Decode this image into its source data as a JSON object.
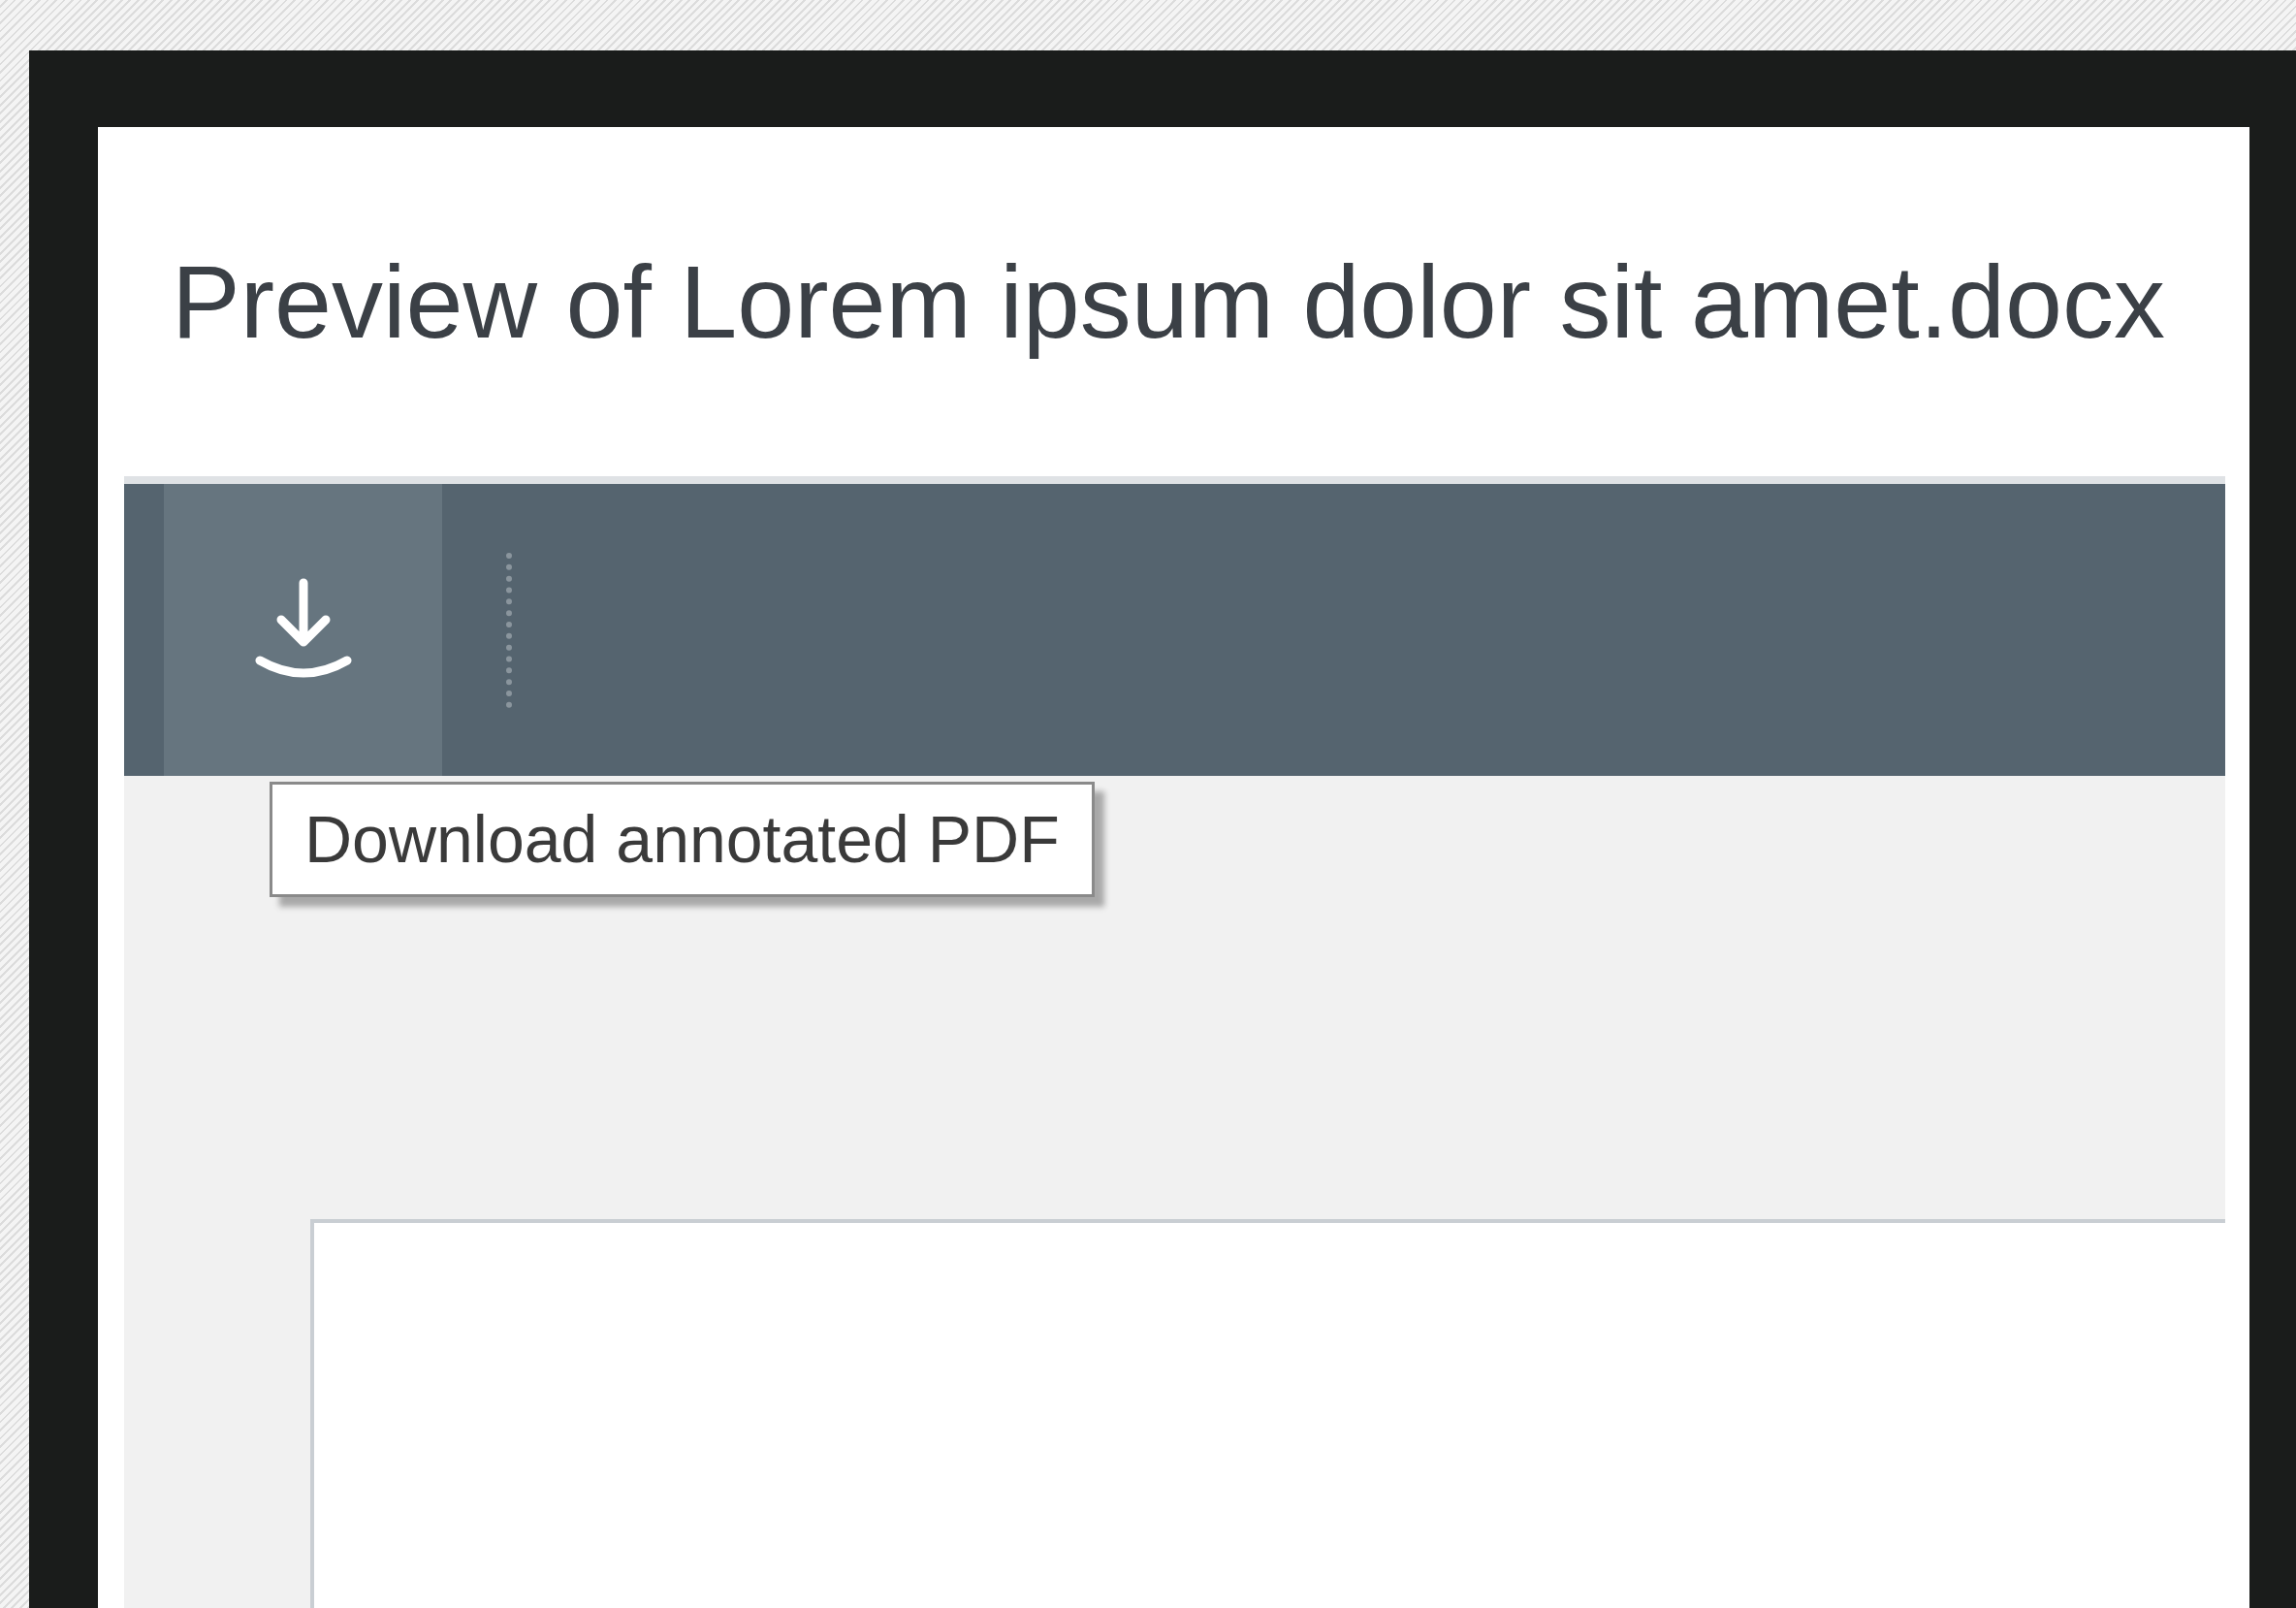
{
  "dialog": {
    "title": "Preview of Lorem ipsum dolor sit amet.docx"
  },
  "toolbar": {
    "buttons": [
      {
        "kind": "download",
        "hovered": true
      }
    ]
  },
  "tooltip": {
    "text": "Download annotated PDF"
  }
}
